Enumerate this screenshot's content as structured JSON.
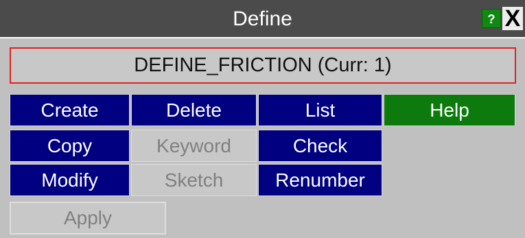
{
  "window": {
    "title": "Define",
    "help_icon_glyph": "?",
    "close_icon_glyph": "X"
  },
  "current": {
    "label": "DEFINE_FRICTION (Curr: 1)"
  },
  "buttons": {
    "create": "Create",
    "delete": "Delete",
    "list": "List",
    "help": "Help",
    "copy": "Copy",
    "keyword": "Keyword",
    "check": "Check",
    "modify": "Modify",
    "sketch": "Sketch",
    "renumber": "Renumber",
    "apply": "Apply"
  },
  "colors": {
    "title_bar": "#4b4b4b",
    "active_button": "#000080",
    "help_button": "#0d7a0d",
    "highlight_border": "#e02020",
    "panel_bg": "#c0c0c0"
  },
  "icons": {
    "help": "question-mark-icon",
    "close": "close-icon"
  }
}
